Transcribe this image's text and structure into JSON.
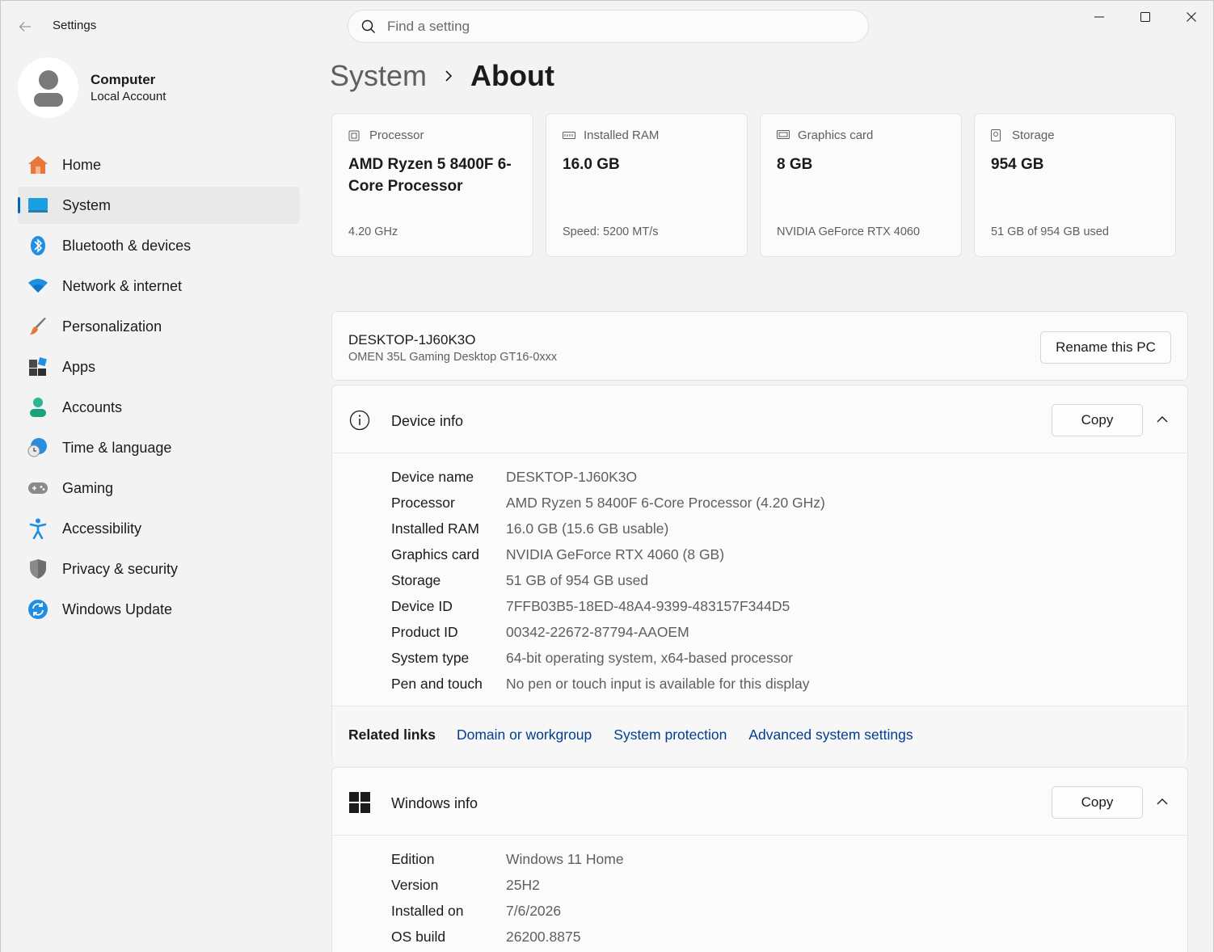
{
  "app": {
    "title": "Settings"
  },
  "search": {
    "placeholder": "Find a setting"
  },
  "profile": {
    "name": "Computer",
    "account_type": "Local Account"
  },
  "sidebar": {
    "items": [
      {
        "label": "Home",
        "icon": "home-icon",
        "active": false
      },
      {
        "label": "System",
        "icon": "system-icon",
        "active": true
      },
      {
        "label": "Bluetooth & devices",
        "icon": "bluetooth-icon",
        "active": false
      },
      {
        "label": "Network & internet",
        "icon": "wifi-icon",
        "active": false
      },
      {
        "label": "Personalization",
        "icon": "brush-icon",
        "active": false
      },
      {
        "label": "Apps",
        "icon": "apps-icon",
        "active": false
      },
      {
        "label": "Accounts",
        "icon": "person-icon",
        "active": false
      },
      {
        "label": "Time & language",
        "icon": "globe-clock-icon",
        "active": false
      },
      {
        "label": "Gaming",
        "icon": "gamepad-icon",
        "active": false
      },
      {
        "label": "Accessibility",
        "icon": "accessibility-icon",
        "active": false
      },
      {
        "label": "Privacy & security",
        "icon": "shield-icon",
        "active": false
      },
      {
        "label": "Windows Update",
        "icon": "update-icon",
        "active": false
      }
    ]
  },
  "breadcrumb": {
    "parent": "System",
    "current": "About"
  },
  "specs": [
    {
      "label": "Processor",
      "value": "AMD Ryzen 5 8400F 6-Core Processor",
      "sub": "4.20 GHz",
      "icon": "processor-icon"
    },
    {
      "label": "Installed RAM",
      "value": "16.0 GB",
      "sub": "Speed: 5200 MT/s",
      "icon": "ram-icon"
    },
    {
      "label": "Graphics card",
      "value": "8 GB",
      "sub": "NVIDIA GeForce RTX 4060",
      "icon": "graphics-card-icon"
    },
    {
      "label": "Storage",
      "value": "954 GB",
      "sub": "51 GB of 954 GB used",
      "icon": "storage-icon"
    }
  ],
  "pc": {
    "name": "DESKTOP-1J60K3O",
    "model": "OMEN 35L Gaming Desktop GT16-0xxx",
    "rename_label": "Rename this PC"
  },
  "device_info": {
    "title": "Device info",
    "copy_label": "Copy",
    "rows": [
      {
        "key": "Device name",
        "value": "DESKTOP-1J60K3O"
      },
      {
        "key": "Processor",
        "value": "AMD Ryzen 5 8400F 6-Core Processor (4.20 GHz)"
      },
      {
        "key": "Installed RAM",
        "value": "16.0 GB (15.6 GB usable)"
      },
      {
        "key": "Graphics card",
        "value": "NVIDIA GeForce RTX 4060 (8 GB)"
      },
      {
        "key": "Storage",
        "value": "51 GB of 954 GB used"
      },
      {
        "key": "Device ID",
        "value": "7FFB03B5-18ED-48A4-9399-483157F344D5"
      },
      {
        "key": "Product ID",
        "value": "00342-22672-87794-AAOEM"
      },
      {
        "key": "System type",
        "value": "64-bit operating system, x64-based processor"
      },
      {
        "key": "Pen and touch",
        "value": "No pen or touch input is available for this display"
      }
    ]
  },
  "related": {
    "label": "Related links",
    "links": [
      "Domain or workgroup",
      "System protection",
      "Advanced system settings"
    ]
  },
  "windows_info": {
    "title": "Windows info",
    "copy_label": "Copy",
    "rows": [
      {
        "key": "Edition",
        "value": "Windows 11 Home"
      },
      {
        "key": "Version",
        "value": "25H2"
      },
      {
        "key": "Installed on",
        "value": "7/6/2026"
      },
      {
        "key": "OS build",
        "value": "26200.8875"
      }
    ]
  },
  "colors": {
    "accent": "#0067c0",
    "link": "#003e92",
    "background": "#f3f3f3",
    "card": "#fbfbfb"
  }
}
